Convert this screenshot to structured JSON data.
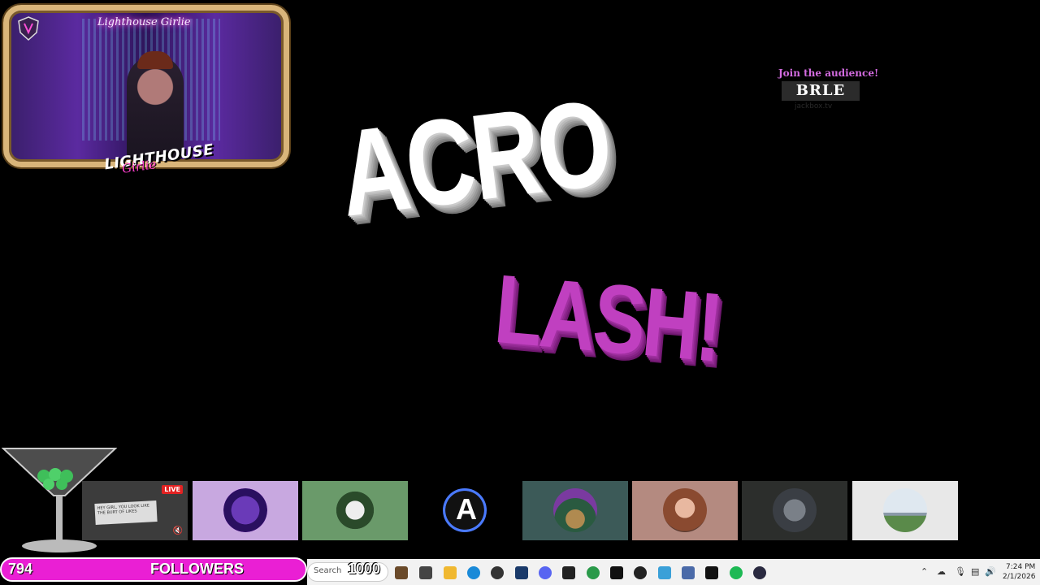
{
  "webcam": {
    "title": "Lighthouse Girlie",
    "brand_line1": "LIGHTHOUSE",
    "brand_line2": "Girlie"
  },
  "audience": {
    "prompt": "Join the audience!",
    "room_code": "BRLE",
    "site": "jackbox.tv"
  },
  "game_title": {
    "line1": "ACRO",
    "line2": "LASH!"
  },
  "tiles": [
    {
      "badge": "LIVE",
      "card_text": "HEY GIRL, YOU LOOK LIKE THE BURT OF LIKES"
    },
    {
      "avatar": "lighthouse-logo"
    },
    {
      "avatar": "green-logo"
    },
    {
      "avatar": "letter-a-logo"
    },
    {
      "avatar": "aurora-logo"
    },
    {
      "avatar": "woman-photo"
    },
    {
      "avatar": "wolf-photo"
    },
    {
      "avatar": "airplane-photo"
    }
  ],
  "followers": {
    "count": "794",
    "label": "FOLLOWERS",
    "goal": "1000"
  },
  "taskbar": {
    "search_placeholder": "Search",
    "time": "7:24 PM",
    "date": "2/1/2026",
    "apps": [
      "file-explorer",
      "edge",
      "chrome",
      "steam",
      "discord",
      "epic-games",
      "chrome-active",
      "vscode",
      "media-player",
      "calculator",
      "capcut",
      "spotify",
      "obs"
    ]
  },
  "colors": {
    "accent_pink": "#ea1fd4",
    "title_purple": "#c040c0",
    "frame_gold": "#d9b57a"
  }
}
